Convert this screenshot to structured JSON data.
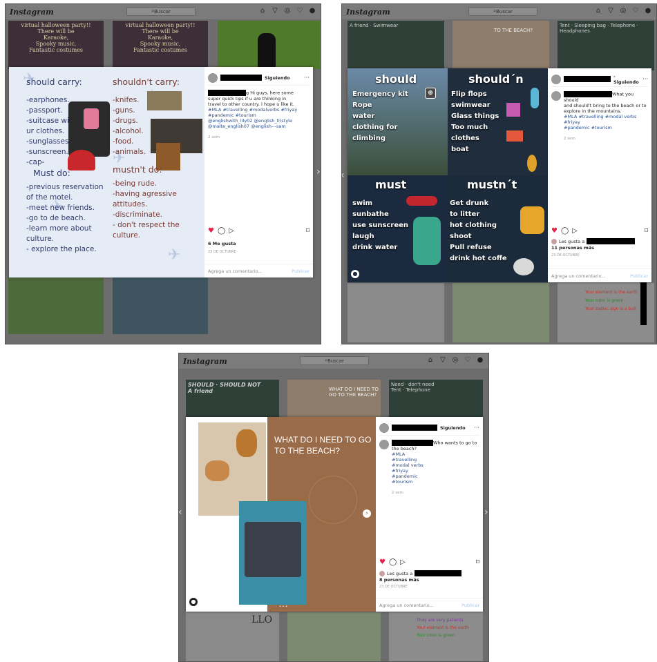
{
  "app": {
    "logo": "Instagram",
    "search_placeholder": "Buscar",
    "nav_icons": [
      "home-icon",
      "direct-icon",
      "explore-icon",
      "heart-icon",
      "profile-avatar"
    ]
  },
  "shot1": {
    "background": {
      "tile_text": "virtual halloween party!! There will be Karaoke, Spooky music, Fantastic costumes"
    },
    "poster": {
      "left_heading": "should carry:",
      "left_items": [
        "-earphones.",
        "-passport.",
        "-suitcase with",
        "ur clothes.",
        "-sunglasses.",
        "-sunscreen.",
        "-cap-"
      ],
      "must_heading": "Must do:",
      "must_items": [
        "-previous reservation",
        "of the motel.",
        "-meet new friends.",
        "-go to de beach.",
        "-learn more about",
        "culture.",
        "- explore the place."
      ],
      "right_heading": "shouldn't carry:",
      "right_items": [
        "-knifes.",
        "-guns.",
        "-drugs.",
        "-alcohol.",
        "-food.",
        "-animals."
      ],
      "mustnt_heading": "mustn't do:",
      "mustnt_items": [
        "-being rude.",
        "-having agressive",
        "attitudes.",
        "-discriminate.",
        "- don't respect the",
        "culture."
      ]
    },
    "side": {
      "following": "Siguiendo",
      "more": "···",
      "caption_lines": [
        "g Hi guys, here some",
        "super quick tips if u are thinking in",
        "travel to other country. I hope u like it."
      ],
      "tags": [
        "#MLA #travelling #modalverbs #friyay",
        "#pandemic #tourism",
        "@englishwith_lily02 @english_fristyle",
        "@malte_english07 @english---sam"
      ],
      "time": "2 sem",
      "likes": "6 Me gusta",
      "date": "23 DE OCTUBRE",
      "comment_placeholder": "Agrega un comentario...",
      "publish": "Publicar"
    }
  },
  "shot2": {
    "background": {
      "tiles": [
        "A friend",
        "Swimwear",
        "TO THE BEACH?",
        "Tent",
        "Sleeping bag",
        "Telephone",
        "Headphones"
      ]
    },
    "poster": {
      "should": {
        "title": "should",
        "items": [
          "Emergency kit",
          "Rope",
          "water",
          "clothing for",
          "climbing"
        ]
      },
      "shouldnt": {
        "title": "should´n",
        "items": [
          "Flip flops",
          "swimwear",
          "Glass things",
          "Too much",
          "clothes",
          "boat"
        ]
      },
      "must": {
        "title": "must",
        "items": [
          "swim",
          "sunbathe",
          "use sunscreen",
          "laugh",
          "drink water"
        ]
      },
      "mustnt": {
        "title": "mustn´t",
        "items": [
          "Get drunk",
          "to litter",
          "hot clothing",
          "shoot",
          "Pull refuse",
          "drink hot coffe"
        ]
      }
    },
    "side": {
      "following": "- Siguiendo",
      "more": "···",
      "caption_lines": [
        "What you should",
        "and should't bring to the beach or to",
        "explore in the mountains."
      ],
      "tags": [
        "#MLA #travelling #modal verbs #friyay",
        "#pandemic #tourism"
      ],
      "time": "2 sem",
      "likes_prefix": "Les gusta a",
      "likes_others": "11 personas más",
      "date": "23 DE OCTUBRE",
      "comment_placeholder": "Agrega un comentario...",
      "publish": "Publicar"
    },
    "bottom_tiles": [
      "Your element is the earth",
      "Your color is green",
      "Your zodiac sign is a bull"
    ]
  },
  "shot3": {
    "background": {
      "tiles": [
        "SHOULD",
        "SHOULD NOT",
        "A friend",
        "WHAT DO I NEED TO GO TO THE BEACH?",
        "Need",
        "don't need",
        "Tent",
        "Telephone"
      ]
    },
    "poster": {
      "title": "WHAT DO I NEED TO GO TO THE BEACH?"
    },
    "side": {
      "following": "Siguiendo",
      "more": "···",
      "caption_lines": [
        "Who wants to go to",
        "the beach?"
      ],
      "tags": [
        "#MLA",
        "#travelling",
        "#modal verbs",
        "#friyay",
        "#pandemic",
        "#tourism"
      ],
      "time": "2 sem",
      "likes_prefix": "Les gusta a",
      "likes_others": "8 personas más",
      "date": "23 DE OCTUBRE",
      "comment_placeholder": "Agrega un comentario...",
      "publish": "Publicar"
    },
    "bottom_tiles": [
      "LLO",
      "They are very patients",
      "Your element is the earth",
      "Your color is green"
    ]
  },
  "colors": {
    "heart": "#e0224b",
    "link_tags": "#2a4e8a",
    "overlay_bg": "#6d6d6d",
    "poster1_bg": "#e6ecf5",
    "poster2_panel": "#1f2c3f",
    "poster3_brown": "#9a6b48"
  }
}
